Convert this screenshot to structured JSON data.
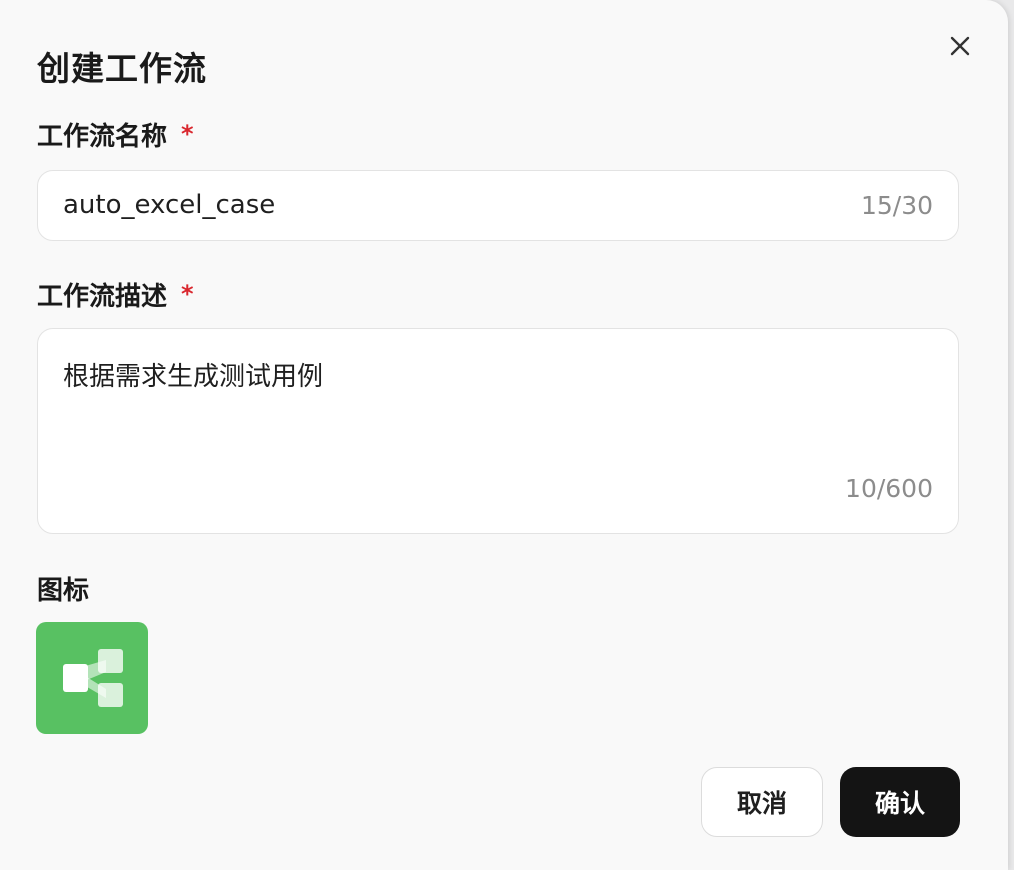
{
  "dialog": {
    "title": "创建工作流",
    "close_icon": "close-icon"
  },
  "name_field": {
    "label": "工作流名称",
    "required_mark": "*",
    "value": "auto_excel_case",
    "count": "15/30"
  },
  "description_field": {
    "label": "工作流描述",
    "required_mark": "*",
    "value": "根据需求生成测试用例",
    "count": "10/600"
  },
  "icon_field": {
    "label": "图标",
    "icon": "workflow-icon",
    "tile_color": "#58c162"
  },
  "actions": {
    "cancel_label": "取消",
    "confirm_label": "确认",
    "confirm_color": "#141414"
  },
  "colors": {
    "required": "#d9272e",
    "counter": "#8c8c8c"
  }
}
